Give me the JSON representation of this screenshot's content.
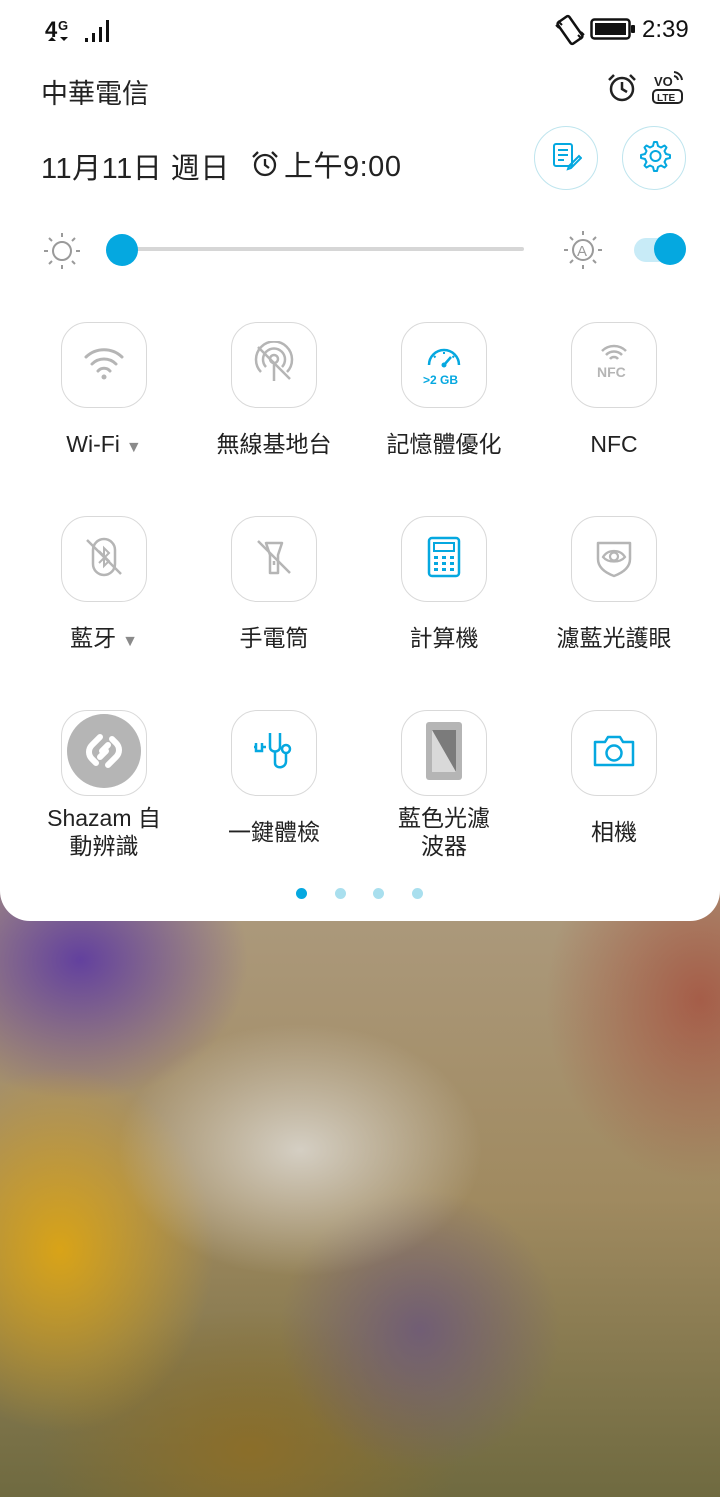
{
  "status_bar": {
    "network": "4G",
    "time": "2:39",
    "icons": [
      "network-4g-icon",
      "signal-icon",
      "vibrate-icon",
      "battery-icon"
    ]
  },
  "header": {
    "carrier": "中華電信",
    "date": "11月11日 週日",
    "alarm_time": "上午9:00",
    "icons": [
      "alarm-icon",
      "volte-icon",
      "edit-icon",
      "settings-icon"
    ],
    "volte_text_top": "VO",
    "volte_text_bottom": "LTE"
  },
  "brightness": {
    "level": 0,
    "auto": true
  },
  "tiles": [
    {
      "label": "Wi-Fi",
      "icon": "wifi-icon",
      "active": false,
      "has_caret": true
    },
    {
      "label": "無線基地台",
      "icon": "hotspot-off-icon",
      "active": false,
      "has_caret": false
    },
    {
      "label": "記憶體優化",
      "icon": "boost-icon",
      "active": true,
      "badge": ">2 GB",
      "has_caret": false
    },
    {
      "label": "NFC",
      "icon": "nfc-icon",
      "active": false,
      "has_caret": false,
      "icon_text": "NFC"
    },
    {
      "label": "藍牙",
      "icon": "bluetooth-off-icon",
      "active": false,
      "has_caret": true
    },
    {
      "label": "手電筒",
      "icon": "flashlight-off-icon",
      "active": false,
      "has_caret": false
    },
    {
      "label": "計算機",
      "icon": "calculator-icon",
      "active": true,
      "has_caret": false
    },
    {
      "label": "濾藍光護眼",
      "icon": "eye-care-icon",
      "active": false,
      "has_caret": false
    },
    {
      "label": "Shazam 自\n動辨識",
      "label_line1": "Shazam 自",
      "label_line2": "動辨識",
      "icon": "shazam-icon",
      "active": false
    },
    {
      "label": "一鍵體檢",
      "icon": "stethoscope-icon",
      "active": true
    },
    {
      "label": "藍色光濾\n波器",
      "label_line1": "藍色光濾",
      "label_line2": "波器",
      "icon": "bluelight-filter-icon",
      "active": false
    },
    {
      "label": "相機",
      "icon": "camera-icon",
      "active": true
    }
  ],
  "caret_glyph": "▼",
  "pager": {
    "pages": 4,
    "current": 0
  },
  "colors": {
    "accent": "#05a8e0",
    "inactive": "#b5b5b5",
    "panel": "#ffffff"
  }
}
